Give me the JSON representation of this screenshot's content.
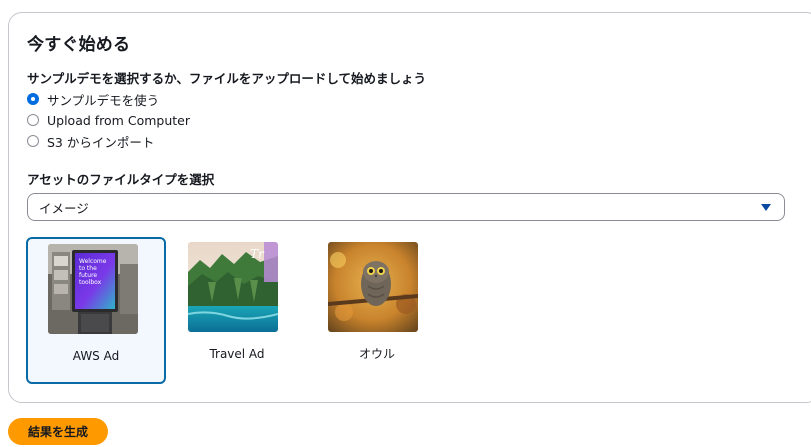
{
  "panel": {
    "title": "今すぐ始める",
    "prompt": "サンプルデモを選択するか、ファイルをアップロードして始めましょう",
    "radio_options": [
      {
        "label": "サンプルデモを使う",
        "checked": true
      },
      {
        "label": "Upload from Computer",
        "checked": false
      },
      {
        "label": "S3 からインポート",
        "checked": false
      }
    ],
    "asset_type_label": "アセットのファイルタイプを選択",
    "asset_type_selected": "イメージ",
    "samples": [
      {
        "label": "AWS Ad",
        "selected": true,
        "thumb_text": "Welcome to the future toolbox"
      },
      {
        "label": "Travel Ad",
        "selected": false
      },
      {
        "label": "オウル",
        "selected": false
      }
    ]
  },
  "actions": {
    "generate_label": "結果を生成"
  },
  "colors": {
    "accent": "#006ce0",
    "primary_button": "#ff9900",
    "selected_border": "#0a6aa6",
    "selected_bg": "#f2f8fd"
  }
}
